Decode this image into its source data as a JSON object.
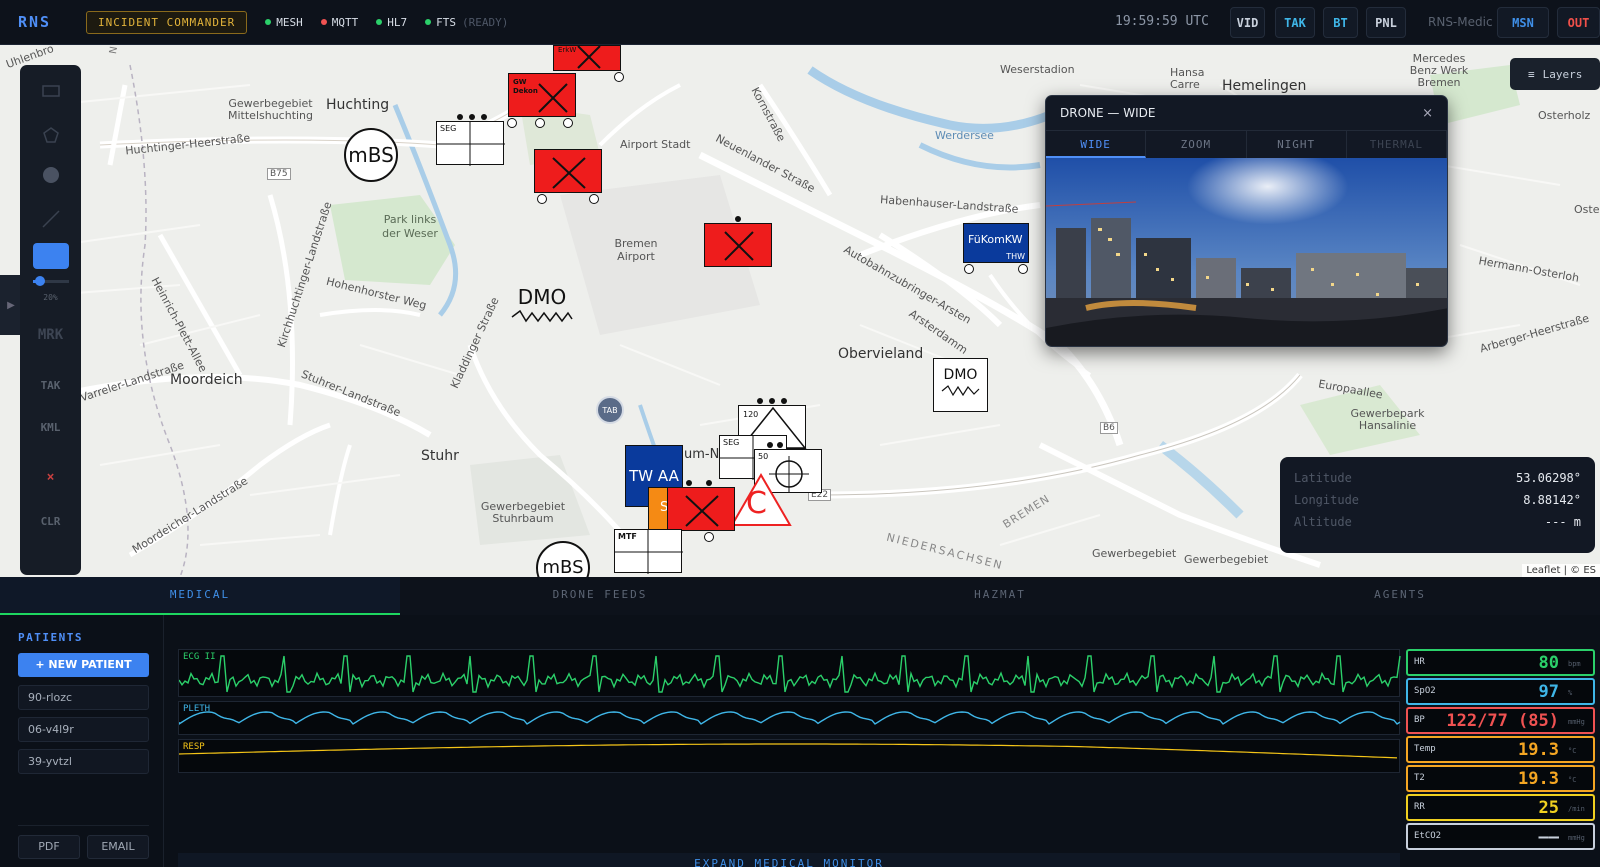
{
  "topbar": {
    "brand": "RNS",
    "role": "INCIDENT COMMANDER",
    "statuses": [
      {
        "label": "MESH",
        "color": "#2bd06a"
      },
      {
        "label": "MQTT",
        "color": "#f05252"
      },
      {
        "label": "HL7",
        "color": "#2bd06a"
      },
      {
        "label": "FTS",
        "sub": "(READY)",
        "color": "#2bd06a"
      }
    ],
    "clock": "19:59:59 UTC",
    "buttons": [
      {
        "label": "VID",
        "color": "#c8d0dc"
      },
      {
        "label": "TAK",
        "color": "#3fb6e8"
      },
      {
        "label": "BT",
        "color": "#3fb6e8"
      },
      {
        "label": "PNL",
        "color": "#c8d0dc"
      }
    ],
    "node_name": "RNS-Medic",
    "msn": {
      "label": "MSN",
      "color": "#3f8fe8"
    },
    "out": {
      "label": "OUT",
      "color": "#f0504a"
    }
  },
  "map": {
    "labels": {
      "huchting": "Huchting",
      "gewerbe_mittels": "Gewerbegebiet Mittelshuchting",
      "huchtinger_heerstr": "Huchtinger-Heerstraße",
      "b75": "B75",
      "airport_stadt": "Airport Stadt",
      "bremen_airport": "Bremen Airport",
      "park_links": "Park links der Weser",
      "hohenhorster": "Hohenhorster Weg",
      "heinrich": "Heinrich-Plett-Allee",
      "kirchhuchtinger": "Kirchhuchtinger-Landstraße",
      "moordeich": "Moordeich",
      "varreler": "Varreler-Landstraße",
      "stuhrer": "Stuhrer-Landstraße",
      "stuhr": "Stuhr",
      "gewerbe_stuhr": "Gewerbegebiet Stuhrbaum",
      "moordeicher": "Moordeicher-Landstraße",
      "kladdinger": "Kladdinger Straße",
      "neuenlander": "Neuenlander Straße",
      "kornstr": "Kornstraße",
      "weserstadion": "Weserstadion",
      "hansa_carre": "Hansa Carre",
      "hemelingen": "Hemelingen",
      "mercedes": "Mercedes Benz Werk Bremen",
      "werdersee": "Werdersee",
      "habenhauser": "Habenhauser-Landstraße",
      "autobahnzubringer": "Autobahnzubringer-Arsten",
      "arsterdamm": "Arsterdamm",
      "obervieland": "Obervieland",
      "europaallee": "Europaallee",
      "gewerbepark": "Gewerbepark Hansalinie",
      "hermann": "Hermann-Osterloh",
      "arberger": "Arberger-Heerstraße",
      "osterholz": "Osterholz",
      "b6": "B6",
      "bremen": "BREMEN",
      "niedersachsen": "NIEDERSACHSEN",
      "gewerbegebiet_se": "Gewerbegebiet",
      "e22": "E22",
      "uhlenbro": "Uhlenbro",
      "ost": "Oste"
    },
    "units": {
      "mbs": "mBS",
      "seg": "SEG",
      "gw_dekon": "GW Dekon",
      "erkw": "ErkW",
      "dmo": "DMO",
      "fukomkw": "FüKomKW",
      "thw": "THW",
      "tab": "TAB",
      "tw_aa": "TW AA",
      "n120": "120",
      "n50": "50",
      "mtf": "MTF",
      "c": "C",
      "s": "S",
      "um_n": "um-N",
      "mbs2": "mBS"
    },
    "rail": {
      "opacity_value": "20%",
      "mrk": "MRK",
      "tak": "TAK",
      "kml": "KML",
      "clear_x": "×",
      "clr": "CLR",
      "color_accent": "#3c82f0"
    },
    "layers_label": "Layers",
    "drone": {
      "title": "DRONE — WIDE",
      "close": "×",
      "tabs": [
        "WIDE",
        "ZOOM",
        "NIGHT",
        "THERMAL"
      ]
    },
    "coords": {
      "lat_label": "Latitude",
      "lat": "53.06298°",
      "lon_label": "Longitude",
      "lon": "8.88142°",
      "alt_label": "Altitude",
      "alt": "--- m"
    },
    "attribution": "Leaflet | © ES"
  },
  "tabs": [
    "MEDICAL",
    "DRONE FEEDS",
    "HAZMAT",
    "AGENTS"
  ],
  "patients": {
    "heading": "PATIENTS",
    "new_label": "+ NEW PATIENT",
    "items": [
      "90-rlozc",
      "06-v4l9r",
      "39-yvtzl"
    ],
    "pdf": "PDF",
    "email": "EMAIL"
  },
  "monitor": {
    "ecg_label": "ECG II",
    "pleth_label": "PLETH",
    "resp_label": "RESP",
    "expand": "EXPAND MEDICAL MONITOR",
    "vitals": [
      {
        "label": "HR",
        "value": "80",
        "unit": "bpm",
        "color": "#2bd06a"
      },
      {
        "label": "SpO2",
        "value": "97",
        "unit": "%",
        "color": "#3fb6e8"
      },
      {
        "label": "BP",
        "value": "122/77 (85)",
        "unit": "mmHg",
        "color": "#f05252"
      },
      {
        "label": "Temp",
        "value": "19.3",
        "unit": "°C",
        "color": "#f5a623"
      },
      {
        "label": "T2",
        "value": "19.3",
        "unit": "°C",
        "color": "#f5a623"
      },
      {
        "label": "RR",
        "value": "25",
        "unit": "/min",
        "color": "#f0d020"
      },
      {
        "label": "EtCO2",
        "value": "——",
        "unit": "mmHg",
        "color": "#c8d0dc"
      }
    ]
  }
}
